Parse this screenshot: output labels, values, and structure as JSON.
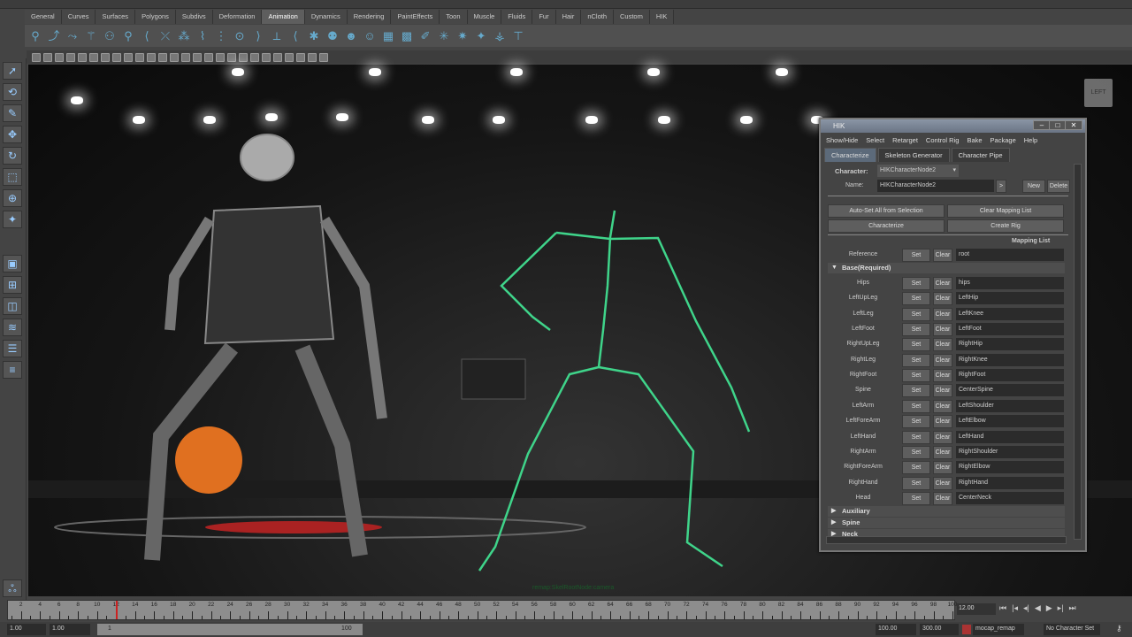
{
  "shelf": {
    "tabs": [
      "General",
      "Curves",
      "Surfaces",
      "Polygons",
      "Subdivs",
      "Deformation",
      "Animation",
      "Dynamics",
      "Rendering",
      "PaintEffects",
      "Toon",
      "Muscle",
      "Fluids",
      "Fur",
      "Hair",
      "nCloth",
      "Custom",
      "HIK"
    ],
    "active_tab": "Animation"
  },
  "viewport": {
    "viewcube_label": "LEFT",
    "camera_label": "remap:SkelRootNode:camera"
  },
  "hik": {
    "title": "HIK",
    "menu": [
      "Show/Hide",
      "Select",
      "Retarget",
      "Control Rig",
      "Bake",
      "Package",
      "Help"
    ],
    "tabs": [
      "Characterize",
      "Skeleton Generator",
      "Character Pipe"
    ],
    "character_label": "Character:",
    "character_value": "HIKCharacterNode2",
    "name_label": "Name:",
    "name_value": "HIKCharacterNode2",
    "arrow_button": ">",
    "new_button": "New",
    "delete_button": "Delete",
    "auto_set_button": "Auto-Set All from Selection",
    "clear_mapping_button": "Clear Mapping List",
    "characterize_button": "Characterize",
    "create_rig_button": "Create Rig",
    "mapping_list_label": "Mapping List",
    "reference": {
      "label": "Reference",
      "value": "root"
    },
    "set_label": "Set",
    "clear_label": "Clear",
    "base_section": "Base(Required)",
    "rows": [
      {
        "label": "Hips",
        "value": "hips"
      },
      {
        "label": "LeftUpLeg",
        "value": "LeftHip"
      },
      {
        "label": "LeftLeg",
        "value": "LeftKnee"
      },
      {
        "label": "LeftFoot",
        "value": "LeftFoot"
      },
      {
        "label": "RightUpLeg",
        "value": "RightHip"
      },
      {
        "label": "RightLeg",
        "value": "RightKnee"
      },
      {
        "label": "RightFoot",
        "value": "RightFoot"
      },
      {
        "label": "Spine",
        "value": "CenterSpine"
      },
      {
        "label": "LeftArm",
        "value": "LeftShoulder"
      },
      {
        "label": "LeftForeArm",
        "value": "LeftElbow"
      },
      {
        "label": "LeftHand",
        "value": "LeftHand"
      },
      {
        "label": "RightArm",
        "value": "RightShoulder"
      },
      {
        "label": "RightForeArm",
        "value": "RightElbow"
      },
      {
        "label": "RightHand",
        "value": "RightHand"
      },
      {
        "label": "Head",
        "value": "CenterNeck"
      }
    ],
    "collapsed_sections": [
      "Auxiliary",
      "Spine",
      "Neck"
    ]
  },
  "timeline": {
    "current_time": "12.00",
    "start": "1.00",
    "playback_start": "1.00",
    "range_min": "1",
    "range_max": "100",
    "playback_end": "100.00",
    "end": "300.00",
    "anim_layer": "mocap_remap",
    "character_set": "No Character Set"
  }
}
